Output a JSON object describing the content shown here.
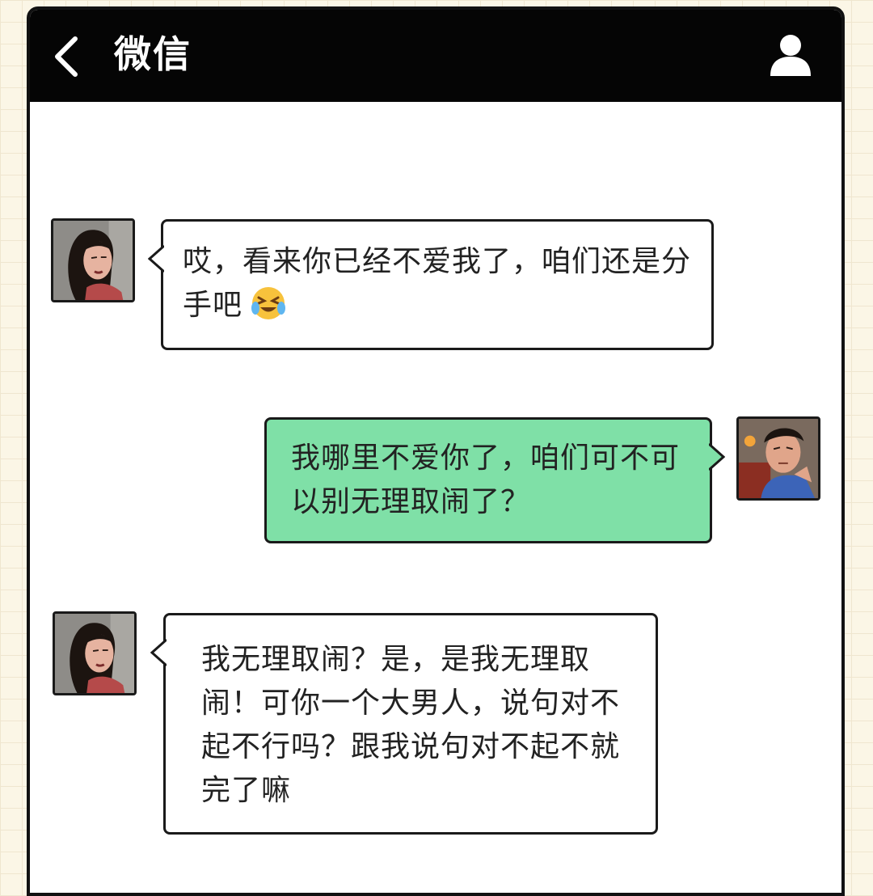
{
  "header": {
    "title": "微信",
    "back_icon": "chevron-left-icon",
    "profile_icon": "person-icon",
    "background": "#050505"
  },
  "messages": [
    {
      "sender": "girlfriend",
      "side": "left",
      "text": "哎，看来你已经不爱我了，咱们还是分手吧",
      "emoji": "crying-laughing-emoji"
    },
    {
      "sender": "boyfriend",
      "side": "right",
      "text": "我哪里不爱你了，咱们可不可以别无理取闹了？",
      "bubble_color": "#7fe0a7"
    },
    {
      "sender": "girlfriend",
      "side": "left",
      "text": "我无理取闹？是，是我无理取闹！可你一个大男人，说句对不起不行吗？跟我说句对不起不就完了嘛"
    }
  ]
}
